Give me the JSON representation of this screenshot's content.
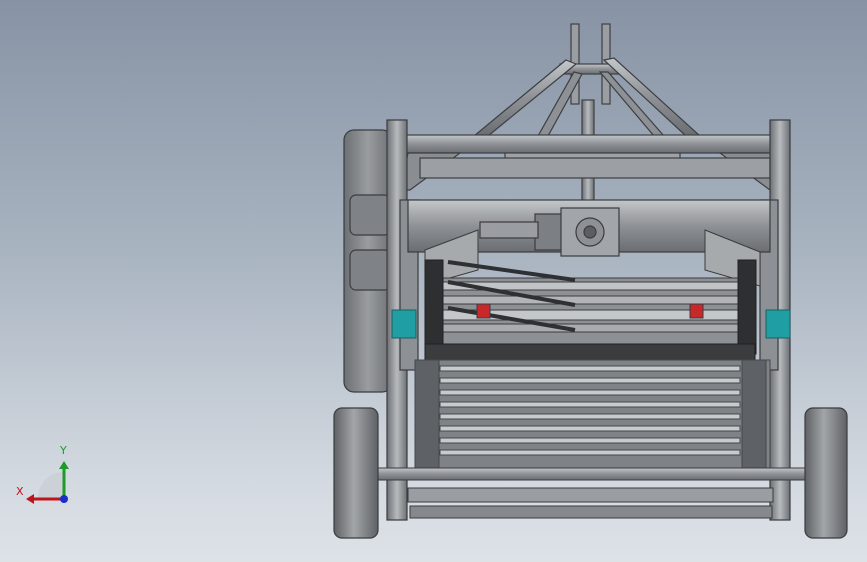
{
  "triad": {
    "x_label": "X",
    "y_label": "Y",
    "x_color": "#c0141b",
    "y_color": "#1f9a2a",
    "z_color": "#1a2fc8"
  },
  "colors": {
    "steel": "#8f9296",
    "steel_light": "#b7babd",
    "steel_dark": "#4a4c4f",
    "accent_teal": "#1f9fa3",
    "accent_red": "#c8282a",
    "tire": "#7b7e82"
  },
  "model": {
    "description_icon": "potato-harvester-model"
  }
}
